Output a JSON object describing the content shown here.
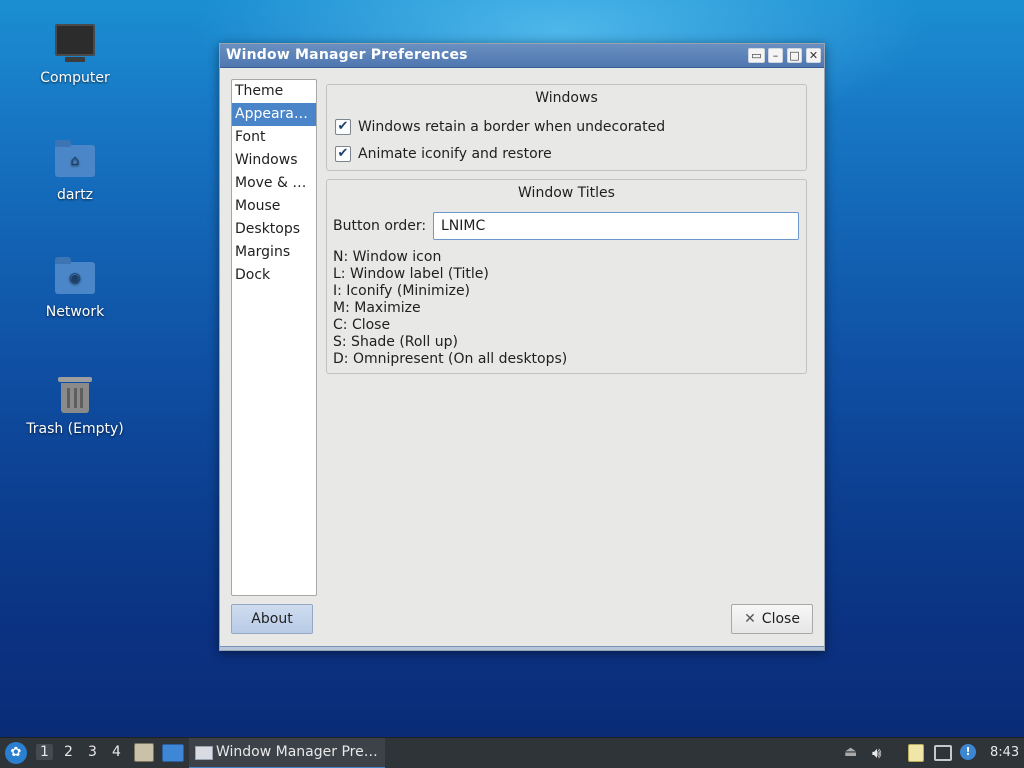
{
  "desktop": {
    "icons": [
      {
        "label": "Computer",
        "icon": "computer-icon"
      },
      {
        "label": "dartz",
        "icon": "home-folder-icon"
      },
      {
        "label": "Network",
        "icon": "network-folder-icon"
      },
      {
        "label": "Trash (Empty)",
        "icon": "trash-icon"
      }
    ]
  },
  "window": {
    "title": "Window Manager Preferences",
    "sidebar": {
      "items": [
        "Theme",
        "Appeara…",
        "Font",
        "Windows",
        "Move & …",
        "Mouse",
        "Desktops",
        "Margins",
        "Dock"
      ],
      "selected": "Appeara…"
    },
    "windows_section": {
      "title": "Windows",
      "options": [
        {
          "label": "Windows retain a border when undecorated",
          "checked": true
        },
        {
          "label": "Animate iconify and restore",
          "checked": true
        }
      ]
    },
    "titles_section": {
      "title": "Window Titles",
      "button_order_label": "Button order:",
      "button_order_value": "LNIMC",
      "legend": [
        "N: Window icon",
        "L: Window label (Title)",
        "I: Iconify (Minimize)",
        "M: Maximize",
        "C: Close",
        "S: Shade (Roll up)",
        "D: Omnipresent (On all desktops)"
      ]
    },
    "about_label": "About",
    "close_label": "Close"
  },
  "taskbar": {
    "workspaces": [
      "1",
      "2",
      "3",
      "4"
    ],
    "current_workspace": "1",
    "task_label": "Window Manager Pre…",
    "clock": "8:43"
  },
  "colors": {
    "accent": "#4a84c9",
    "titlebar": "#5a80b8",
    "taskbar": "#2f3438"
  }
}
